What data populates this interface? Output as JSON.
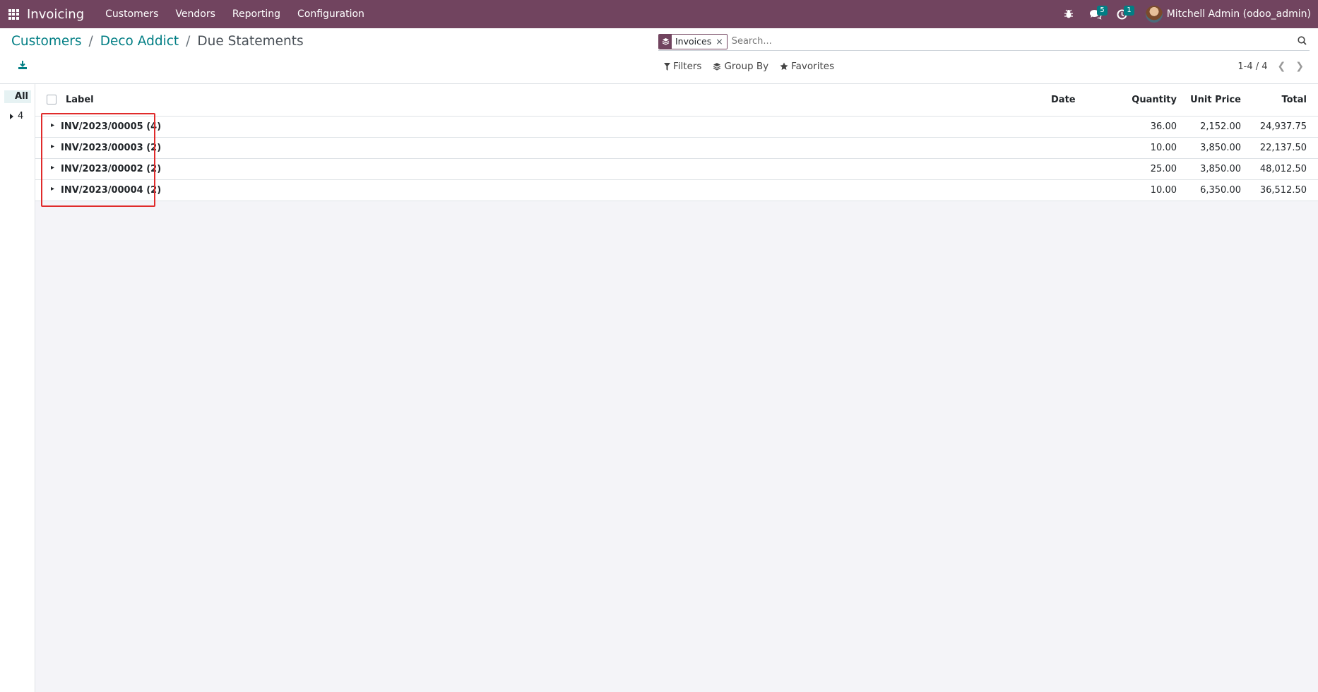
{
  "navbar": {
    "app_title": "Invoicing",
    "menu": [
      "Customers",
      "Vendors",
      "Reporting",
      "Configuration"
    ],
    "messages_count": "5",
    "activities_count": "1",
    "user": "Mitchell Admin (odoo_admin)"
  },
  "breadcrumb": {
    "items": [
      "Customers",
      "Deco Addict"
    ],
    "current": "Due Statements"
  },
  "search": {
    "facet_label": "Invoices",
    "facet_remove": "×",
    "placeholder": "Search..."
  },
  "filters": {
    "filters_label": "Filters",
    "groupby_label": "Group By",
    "favorites_label": "Favorites"
  },
  "pager": {
    "value": "1-4 / 4"
  },
  "side_panel": {
    "all_label": "All",
    "value": "4"
  },
  "table": {
    "headers": {
      "label": "Label",
      "date": "Date",
      "quantity": "Quantity",
      "unit_price": "Unit Price",
      "total": "Total"
    },
    "rows": [
      {
        "label": "INV/2023/00005 (4)",
        "quantity": "36.00",
        "unit_price": "2,152.00",
        "total": "24,937.75"
      },
      {
        "label": "INV/2023/00003 (2)",
        "quantity": "10.00",
        "unit_price": "3,850.00",
        "total": "22,137.50"
      },
      {
        "label": "INV/2023/00002 (2)",
        "quantity": "25.00",
        "unit_price": "3,850.00",
        "total": "48,012.50"
      },
      {
        "label": "INV/2023/00004 (2)",
        "quantity": "10.00",
        "unit_price": "6,350.00",
        "total": "36,512.50"
      }
    ]
  },
  "colors": {
    "navbar": "#71445f",
    "accent": "#017e84",
    "highlight": "#e02b2b"
  }
}
